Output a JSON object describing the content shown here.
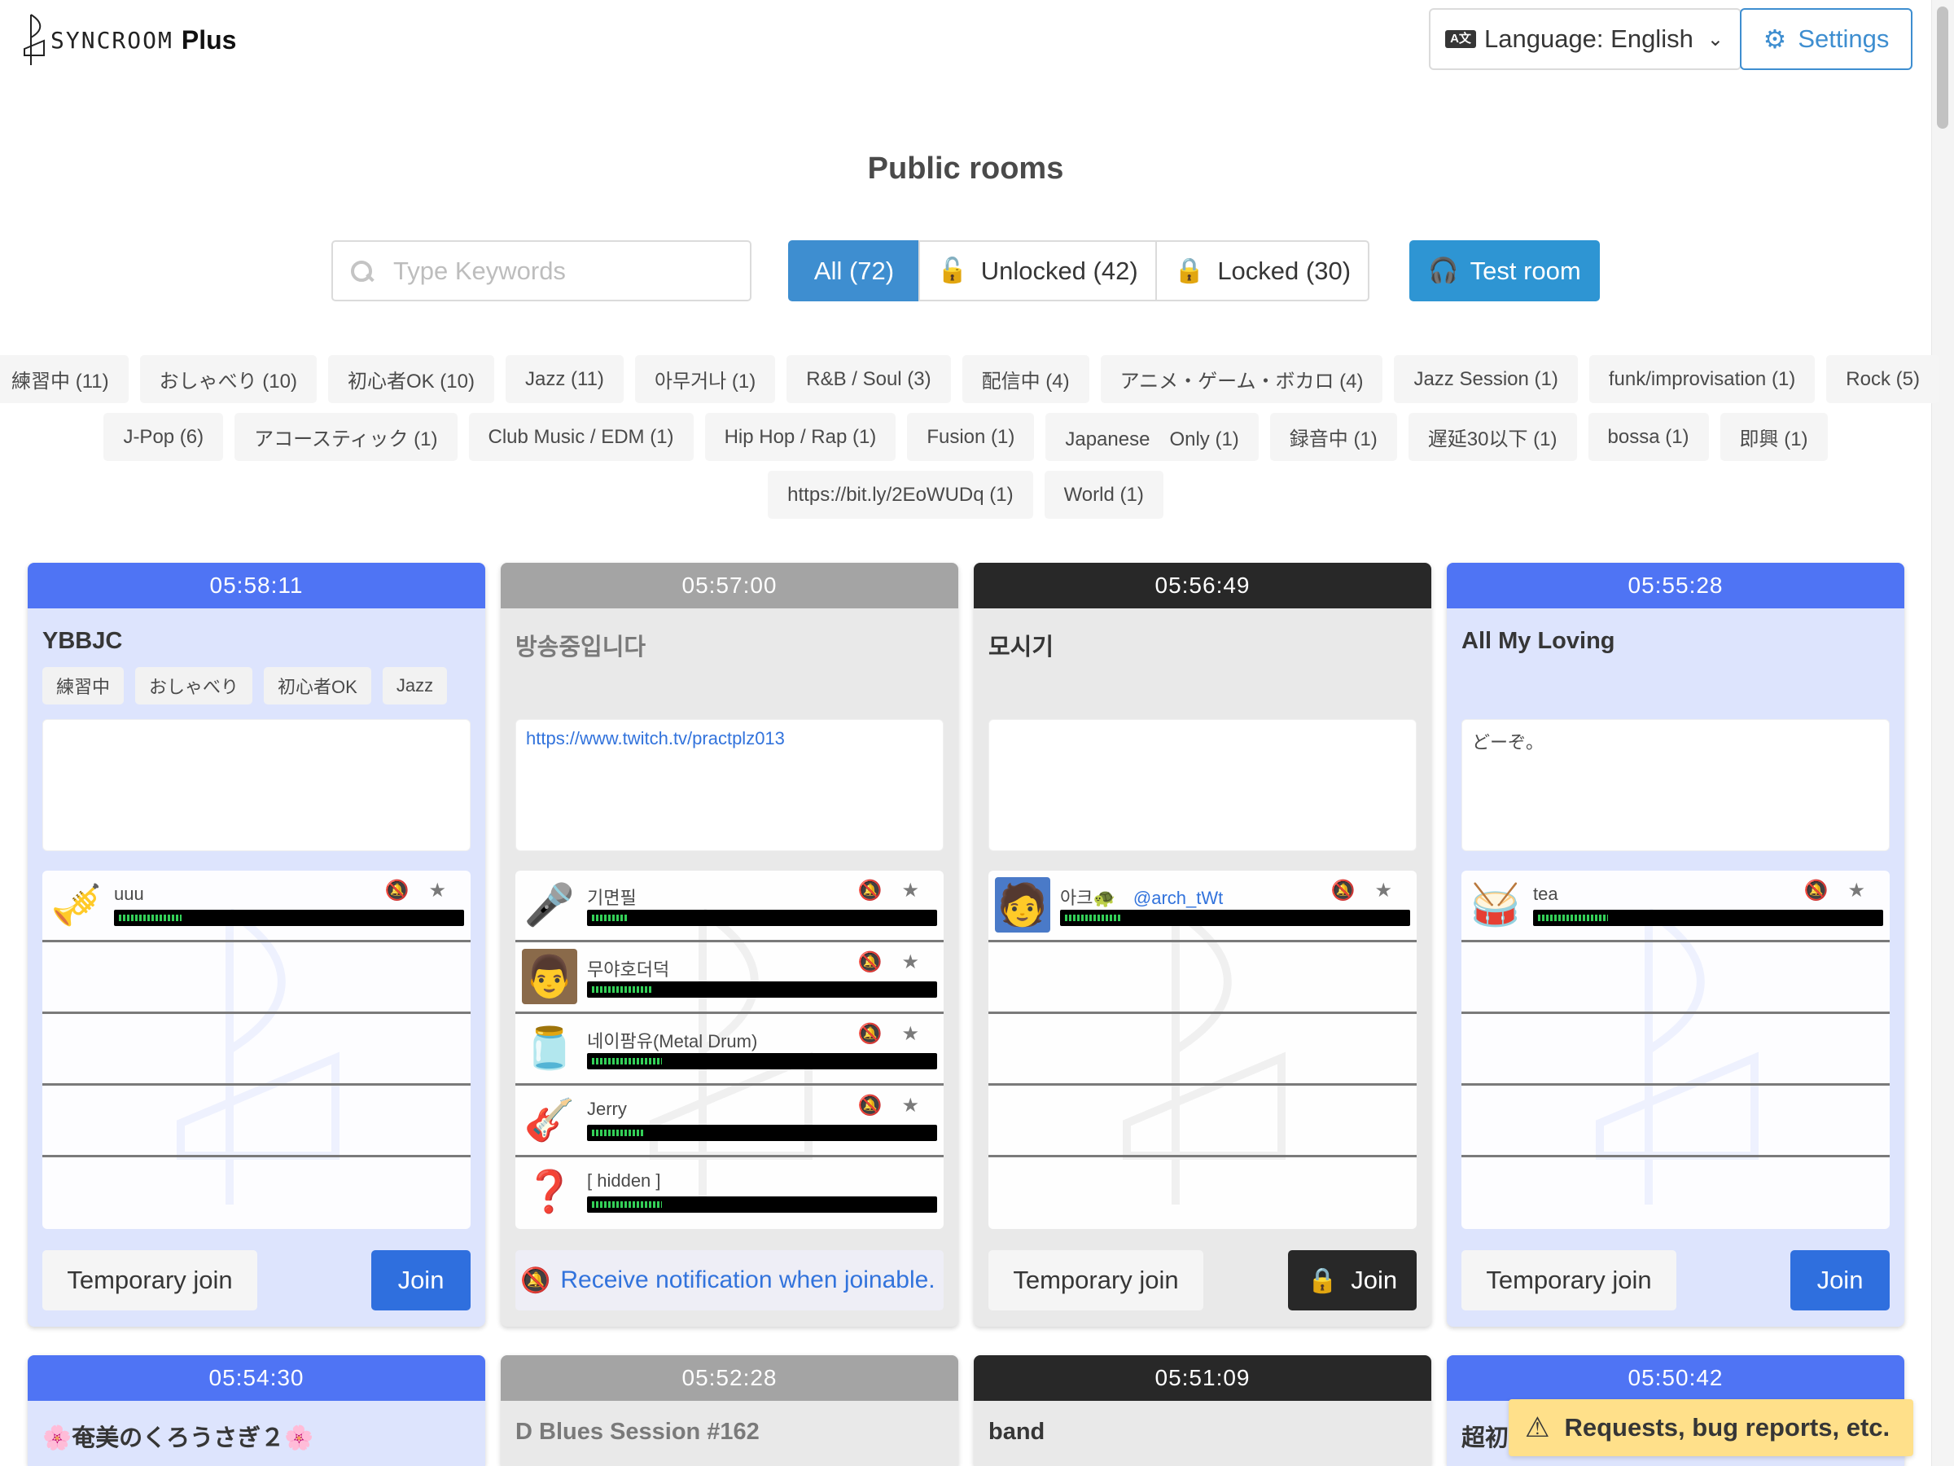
{
  "app": {
    "logo_text": "SYNCROOM",
    "logo_suffix": "Plus"
  },
  "header": {
    "language_label": "Language: English",
    "language_icon": "translate-icon",
    "settings_label": "Settings",
    "settings_icon": "gear-icon"
  },
  "page_title": "Public rooms",
  "search": {
    "placeholder": "Type Keywords",
    "value": ""
  },
  "filters": {
    "all": "All (72)",
    "unlocked": "Unlocked (42)",
    "locked": "Locked (30)",
    "active": "all"
  },
  "test_room_label": "Test room",
  "tags_row1": [
    "練習中 (11)",
    "おしゃべり (10)",
    "初心者OK (10)",
    "Jazz (11)",
    "아무거나 (1)",
    "R&B / Soul (3)",
    "配信中 (4)",
    "アニメ・ゲーム・ボカロ (4)",
    "Jazz Session (1)",
    "funk/improvisation (1)",
    "Rock (5)"
  ],
  "tags_row2": [
    "J-Pop (6)",
    "アコースティック (1)",
    "Club Music / EDM (1)",
    "Hip Hop / Rap (1)",
    "Fusion (1)",
    "Japanese　Only (1)",
    "録音中 (1)",
    "遅延30以下 (1)",
    "bossa (1)",
    "即興 (1)"
  ],
  "tags_row3": [
    "https://bit.ly/2EoWUDq (1)",
    "World (1)"
  ],
  "colors": {
    "blue_head": "#4f74f4",
    "gray_head": "#a4a4a4",
    "black_head": "#282828",
    "blue_body": "#dde4fd",
    "gray_body": "#e9e9e9",
    "accent": "#3e8ed0",
    "join_blue": "#2f6fde"
  },
  "rooms": [
    {
      "time": "05:58:11",
      "title": "YBBJC",
      "tags": [
        "練習中",
        "おしゃべり",
        "初心者OK",
        "Jazz"
      ],
      "description": "",
      "members": [
        {
          "name": "uuu",
          "avatar": "trumpet-icon",
          "level": 0.18
        }
      ],
      "temp_join_label": "Temporary join",
      "join_label": "Join"
    },
    {
      "time": "05:57:00",
      "title": "방송중입니다",
      "tags": [],
      "description_link": "https://www.twitch.tv/practplz013",
      "members": [
        {
          "name": "기면필",
          "avatar": "microphone-icon",
          "level": 0.1
        },
        {
          "name": "무야호더덕",
          "avatar": "photo-avatar",
          "level": 0.17
        },
        {
          "name": "네이팜유(Metal Drum)",
          "avatar": "jar-icon",
          "level": 0.2
        },
        {
          "name": "Jerry",
          "avatar": "guitar-icon",
          "level": 0.15
        },
        {
          "name": "[ hidden ]",
          "avatar": "unknown-user-icon",
          "level": 0.2
        }
      ],
      "notify_label": "Receive notification when joinable."
    },
    {
      "time": "05:56:49",
      "title": "모시기",
      "tags": [],
      "description": "",
      "members": [
        {
          "name": "아크🐢",
          "handle": "@arch_tWt",
          "avatar": "anime-avatar",
          "level": 0.16
        }
      ],
      "temp_join_label": "Temporary join",
      "join_label": "Join"
    },
    {
      "time": "05:55:28",
      "title": "All My Loving",
      "tags": [],
      "description": "どーぞ。",
      "members": [
        {
          "name": "tea",
          "avatar": "drum-kit-icon",
          "level": 0.2
        }
      ],
      "temp_join_label": "Temporary join",
      "join_label": "Join"
    }
  ],
  "rooms_row2": [
    {
      "time": "05:54:30",
      "title": "🌸奄美のくろうさぎ２🌸"
    },
    {
      "time": "05:52:28",
      "title": "D Blues Session #162"
    },
    {
      "time": "05:51:09",
      "title": "band"
    },
    {
      "time": "05:50:42",
      "title": "超初"
    }
  ],
  "feedback_label": "Requests, bug reports, etc."
}
